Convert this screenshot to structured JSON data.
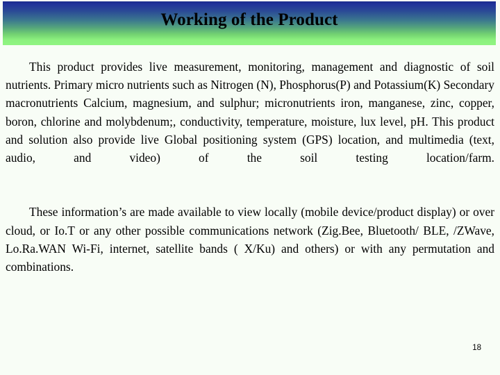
{
  "slide": {
    "title": "Working of the Product",
    "page_number": "18",
    "colors": {
      "gradient_top": "#1a2a8c",
      "gradient_bottom": "#90f582",
      "background": "#f8fdf6",
      "text": "#000000"
    },
    "paragraphs": [
      "This product provides live measurement, monitoring, management and diagnostic of soil nutrients.  Primary micro nutrients such as Nitrogen (N), Phosphorus(P) and Potassium(K) Secondary macronutrients  Calcium, magnesium, and sulphur;  micronutrients iron, manganese, zinc, copper, boron, chlorine and molybdenum;, conductivity, temperature, moisture, lux level, pH.  This product and solution also provide live Global positioning system (GPS) location, and multimedia (text, audio, and video) of the soil testing location/farm.",
      "These information’s are made available to view locally (mobile device/product display) or over cloud, or Io.T or any other possible communications network (Zig.Bee, Bluetooth/ BLE, /ZWave, Lo.Ra.WAN Wi-Fi, internet, satellite bands ( X/Ku) and others) or with any permutation and combinations."
    ]
  }
}
